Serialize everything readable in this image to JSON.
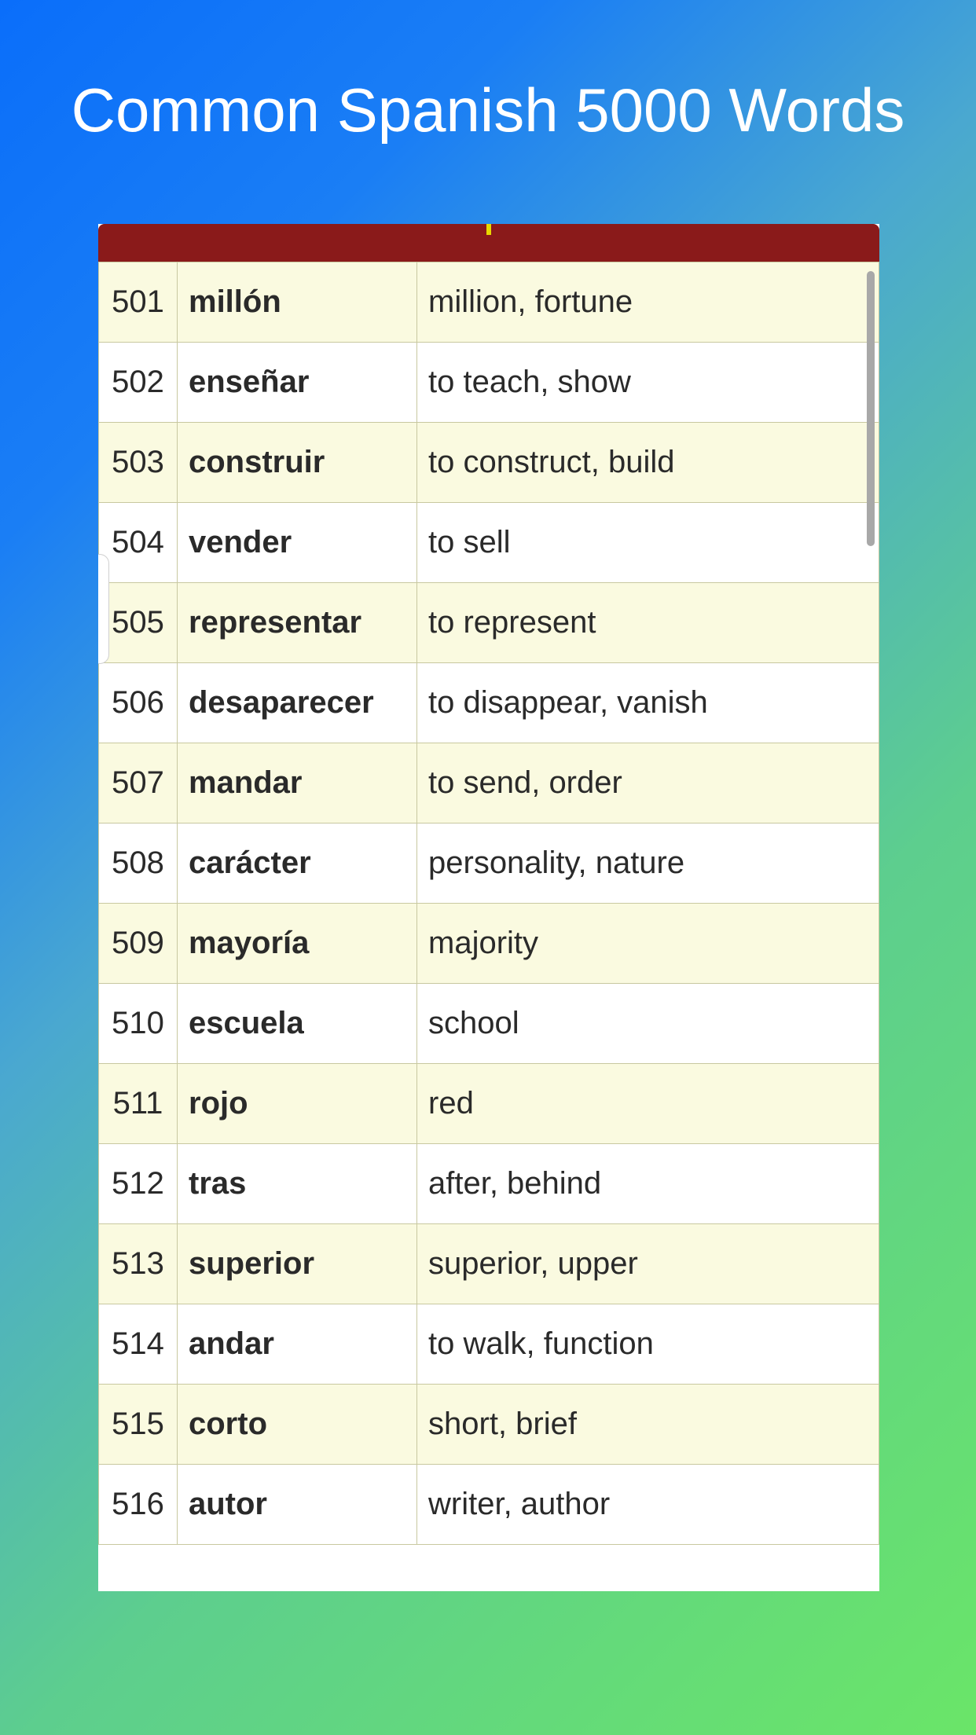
{
  "page": {
    "title": "Common Spanish 5000 Words"
  },
  "vocab": {
    "rows": [
      {
        "num": "501",
        "word": "millón",
        "meaning": "million, fortune"
      },
      {
        "num": "502",
        "word": "enseñar",
        "meaning": "to teach, show"
      },
      {
        "num": "503",
        "word": "construir",
        "meaning": "to construct, build"
      },
      {
        "num": "504",
        "word": "vender",
        "meaning": "to sell"
      },
      {
        "num": "505",
        "word": "representar",
        "meaning": "to represent"
      },
      {
        "num": "506",
        "word": "desaparecer",
        "meaning": "to disappear, vanish"
      },
      {
        "num": "507",
        "word": "mandar",
        "meaning": "to send, order"
      },
      {
        "num": "508",
        "word": "carácter",
        "meaning": "personality, nature"
      },
      {
        "num": "509",
        "word": "mayoría",
        "meaning": "majority"
      },
      {
        "num": "510",
        "word": "escuela",
        "meaning": "school"
      },
      {
        "num": "511",
        "word": "rojo",
        "meaning": "red"
      },
      {
        "num": "512",
        "word": "tras",
        "meaning": "after, behind"
      },
      {
        "num": "513",
        "word": "superior",
        "meaning": "superior, upper"
      },
      {
        "num": "514",
        "word": "andar",
        "meaning": "to walk, function"
      },
      {
        "num": "515",
        "word": "corto",
        "meaning": "short, brief"
      },
      {
        "num": "516",
        "word": "autor",
        "meaning": "writer, author"
      }
    ]
  }
}
